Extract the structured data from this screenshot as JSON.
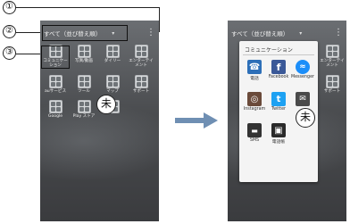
{
  "markers": [
    "①",
    "②",
    "③"
  ],
  "folder_badge": "未",
  "home": {
    "tab_title": "すべて（並び替え順）",
    "caret": "▾",
    "menu_icon": "⋮",
    "apps": [
      {
        "label": "コミュニケー\nション"
      },
      {
        "label": "写真/動画"
      },
      {
        "label": "ダイリー"
      },
      {
        "label": "エンターテイ\nメント"
      },
      {
        "label": "auサービス"
      },
      {
        "label": "ツール"
      },
      {
        "label": "マップ"
      },
      {
        "label": "サポート"
      },
      {
        "label": "Google"
      },
      {
        "label": "Play ストア"
      },
      {
        "label": ""
      },
      {
        "label": ""
      }
    ]
  },
  "folder": {
    "title": "コミュニケーション",
    "apps": [
      {
        "label": "電話",
        "icon": "phone-icon",
        "color": "#2d6fb8",
        "glyph": "☎"
      },
      {
        "label": "Facebook",
        "icon": "facebook-icon",
        "color": "#3b5998",
        "glyph": "f"
      },
      {
        "label": "Messenger",
        "icon": "messenger-icon",
        "color": "#1c8ef9",
        "glyph": "≈"
      },
      {
        "label": "Instagram",
        "icon": "instagram-icon",
        "color": "#6a4a3a",
        "glyph": "◎"
      },
      {
        "label": "Twitter",
        "icon": "twitter-icon",
        "color": "#1da1f2",
        "glyph": "t"
      },
      {
        "label": "",
        "icon": "mail-icon",
        "color": "#4a4a4a",
        "glyph": "✉"
      },
      {
        "label": "SMS",
        "icon": "sms-icon",
        "color": "#333333",
        "glyph": "▬"
      },
      {
        "label": "電話帳",
        "icon": "contacts-icon",
        "color": "#2a2a2a",
        "glyph": "▣"
      }
    ]
  }
}
